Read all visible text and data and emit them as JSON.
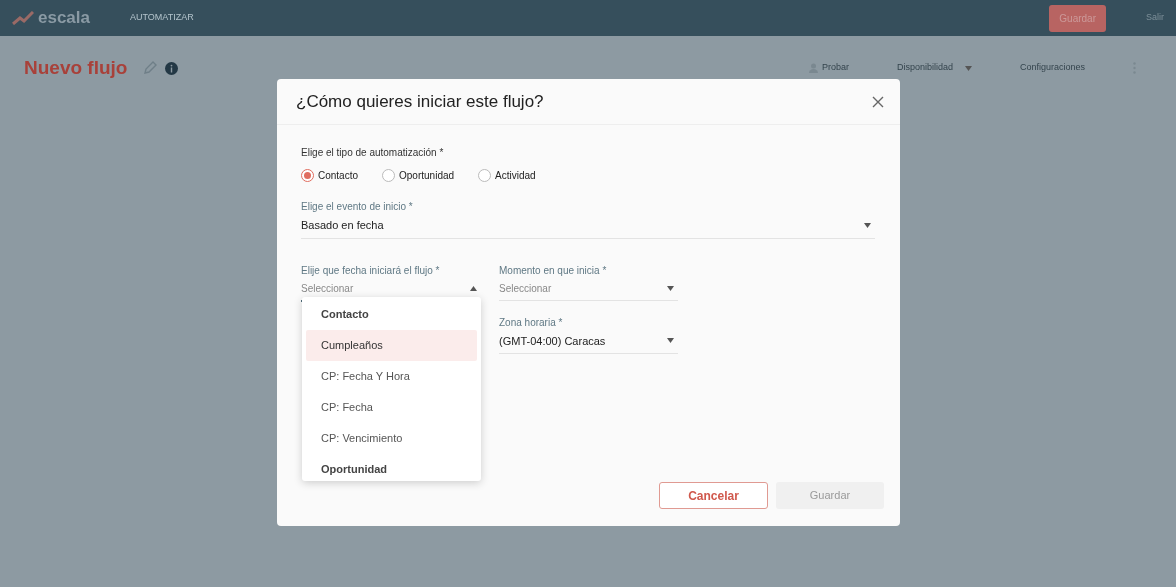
{
  "header": {
    "logo": "escala",
    "section": "AUTOMATIZAR",
    "save_button": "Guardar",
    "logout": "Salir"
  },
  "page": {
    "title": "Nuevo flujo",
    "actions": [
      {
        "label": "Probar",
        "kind": "icon"
      },
      {
        "label": "Disponibilidad",
        "kind": "dropdown"
      },
      {
        "label": "Configuraciones",
        "kind": "plain"
      }
    ]
  },
  "modal": {
    "title": "¿Cómo quieres iniciar este flujo?",
    "type_label": "Elige el tipo de automatización *",
    "types": [
      {
        "label": "Contacto",
        "selected": true
      },
      {
        "label": "Oportunidad",
        "selected": false
      },
      {
        "label": "Actividad",
        "selected": false
      }
    ],
    "event": {
      "label": "Elige el evento de inicio *",
      "value": "Basado en fecha"
    },
    "date_field": {
      "label": "Elije que fecha iniciará el flujo *",
      "placeholder": "Seleccionar",
      "expanded": true
    },
    "moment_field": {
      "label": "Momento en que inicia *",
      "placeholder": "Seleccionar"
    },
    "timezone": {
      "label": "Zona horaria *",
      "value": "(GMT-04:00) Caracas"
    },
    "options": [
      {
        "label": "Contacto",
        "kind": "group",
        "selected": false
      },
      {
        "label": "Cumpleaños",
        "kind": "option",
        "selected": true
      },
      {
        "label": "CP: Fecha Y Hora",
        "kind": "option",
        "selected": false
      },
      {
        "label": "CP: Fecha",
        "kind": "option",
        "selected": false
      },
      {
        "label": "CP: Vencimiento",
        "kind": "option",
        "selected": false
      },
      {
        "label": "Oportunidad",
        "kind": "group",
        "selected": false
      }
    ],
    "cancel": "Cancelar",
    "save": {
      "label": "Guardar",
      "disabled": true
    }
  }
}
